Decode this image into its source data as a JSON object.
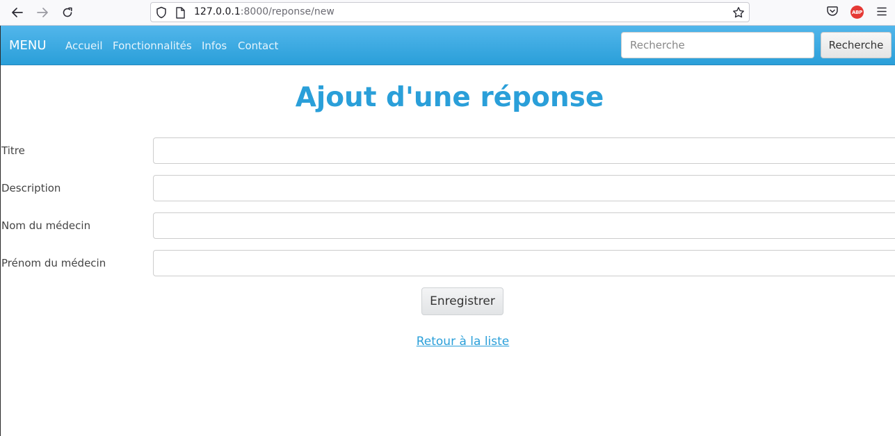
{
  "browser": {
    "url_host": "127.0.0.1",
    "url_path": ":8000/reponse/new",
    "extension_label": "ABP"
  },
  "navbar": {
    "brand": "MENU",
    "links": [
      "Accueil",
      "Fonctionnalités",
      "Infos",
      "Contact"
    ],
    "search_placeholder": "Recherche",
    "search_button": "Recherche"
  },
  "page": {
    "title": "Ajout d'une réponse",
    "fields": [
      {
        "label": "Titre",
        "value": ""
      },
      {
        "label": "Description",
        "value": ""
      },
      {
        "label": "Nom du médecin",
        "value": ""
      },
      {
        "label": "Prénom du médecin",
        "value": ""
      }
    ],
    "save_button": "Enregistrer",
    "back_link": "Retour à la liste"
  },
  "colors": {
    "accent": "#2a9fd9",
    "navbar_top": "#52b6eb",
    "navbar_bottom": "#2a9fd9"
  },
  "icons": [
    "back-arrow-icon",
    "forward-arrow-icon",
    "reload-icon",
    "shield-icon",
    "page-icon",
    "star-icon",
    "pocket-icon",
    "adblock-icon",
    "hamburger-menu-icon"
  ]
}
